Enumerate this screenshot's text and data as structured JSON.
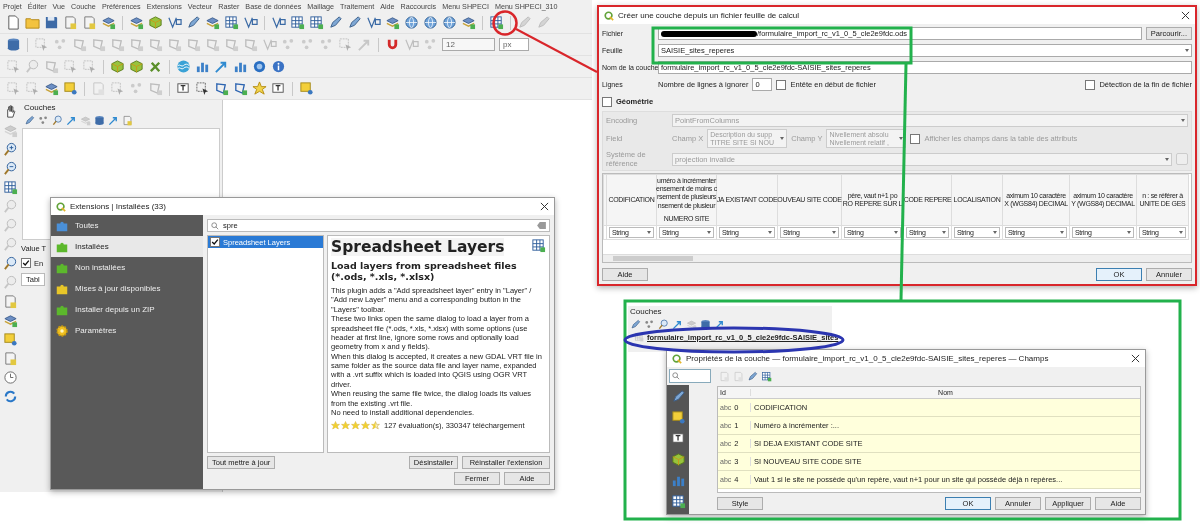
{
  "main_window": {
    "menu": [
      "Projet",
      "Éditer",
      "Vue",
      "Couche",
      "Préférences",
      "Extensions",
      "Vecteur",
      "Raster",
      "Base de données",
      "Maillage",
      "Traitement",
      "Aide",
      "Raccourcis",
      "Menu SHPECI",
      "Menu SHPECI_310"
    ],
    "snapping": {
      "tolerance": "12",
      "unit": "px"
    },
    "layers_panel": {
      "title": "Couches"
    },
    "value_tool": {
      "title": "Value T",
      "checkbox_label": "En",
      "checked": true,
      "tab": "Tabl"
    }
  },
  "extensions_dialog": {
    "title": "Extensions | Installées (33)",
    "sections": [
      {
        "kind": "all",
        "label": "Toutes",
        "selected": false
      },
      {
        "kind": "installed",
        "label": "Installées",
        "selected": true
      },
      {
        "kind": "not_installed",
        "label": "Non installées",
        "selected": false
      },
      {
        "kind": "upgradeable",
        "label": "Mises à jour disponibles",
        "selected": false
      },
      {
        "kind": "zip",
        "label": "Installer depuis un ZIP",
        "selected": false
      },
      {
        "kind": "settings",
        "label": "Paramètres",
        "selected": false
      }
    ],
    "search": {
      "value": "spre"
    },
    "plugins": [
      {
        "name": "Spreadsheet Layers",
        "checked": true,
        "selected": true
      }
    ],
    "details": {
      "title": "Spreadsheet Layers",
      "subtitle": "Load layers from spreadsheet files (*.ods, *.xls, *.xlsx)",
      "paragraphs": [
        "This plugin adds a \"Add spreadsheet layer\" entry in \"Layer\" / \"Add new Layer\" menu and a corresponding button in the \"Layers\" toolbar.",
        "These two links open the same dialog to load a layer from a spreadsheet file (*.ods, *.xls, *.xlsx) with some options (use header at first line, ignore some rows and optionally load geometry from x and y fields).",
        "When this dialog is accepted, it creates a new GDAL VRT file in same folder as the source data file and layer name, expanded with a .vrt suffix which is loaded into QGIS using OGR VRT driver.",
        "When reusing the same file twice, the dialog loads its values from the existing .vrt file.",
        "No need to install additional dependencies."
      ],
      "stars": 4.5,
      "rating": "127 évaluation(s), 330347 téléchargement"
    },
    "buttons": [
      "Tout mettre à jour",
      "Désinstaller",
      "Réinstaller l'extension",
      "Fermer",
      "Aide"
    ]
  },
  "import_dialog": {
    "title": "Créer une couche depuis un fichier feuille de calcul",
    "file": {
      "label": "Fichier",
      "value": "/formulaire_import_rc_v1_0_5_cle2e9fdc.ods",
      "redacted": true,
      "browse": "Parcourir..."
    },
    "sheet": {
      "label": "Feuille",
      "value": "SAISIE_sites_reperes"
    },
    "layer_name": {
      "label": "Nom de la couche",
      "value": "formulaire_import_rc_v1_0_5_cle2e9fdc-SAISIE_sites_reperes"
    },
    "lines": {
      "label": "Lignes",
      "skip_label": "Nombre de lignes à ignorer",
      "skip_value": "0",
      "header_label": "Entête en début de fichier",
      "header_checked": false,
      "eof_label": "Détection de la fin de fichier",
      "eof_checked": false
    },
    "geometry": {
      "label": "Géométrie",
      "checked": false,
      "encoding_label": "Encoding",
      "encoding": "PointFromColumns",
      "field_label": "Field",
      "x_label": "Champ X",
      "x_lines": [
        "Description du supp",
        "TITRE SITE SI NOU"
      ],
      "y_label": "Champ Y",
      "y_lines": [
        "Nivellement absolu",
        "Nivellement relatif ,"
      ],
      "show_label": "Afficher les champs dans la table des attributs",
      "show_checked": false,
      "crs_label": "Système de référence",
      "crs": "projection invalide"
    },
    "columns": [
      {
        "lines": [
          "CODIFICATION"
        ],
        "type": "String"
      },
      {
        "lines": [
          "uméro à incrémenter",
          "ensement de moins c",
          "rsement de plusieurs",
          "nsement de plusieur"
        ],
        "footer": "NUMERO SITE",
        "type": "String"
      },
      {
        "lines": [
          "JA EXISTANT CODE"
        ],
        "type": "String"
      },
      {
        "lines": [
          "OUVEAU SITE CODE"
        ],
        "type": "String"
      },
      {
        "lines": [
          "père, vaut n+1 po",
          "RO REPERE SUR L"
        ],
        "type": "String"
      },
      {
        "lines": [
          "CODE REPERE"
        ],
        "type": "String"
      },
      {
        "lines": [
          "LOCALISATION"
        ],
        "type": "String"
      },
      {
        "lines": [
          "aximum 10 caractère",
          "X (WGS84) DECIMAL"
        ],
        "type": "String"
      },
      {
        "lines": [
          "aximum 10 caractère",
          "Y (WGS84) DECIMAL"
        ],
        "type": "String"
      },
      {
        "lines": [
          "n : se référer à",
          "UNITE DE GES"
        ],
        "type": "String"
      }
    ],
    "buttons": [
      "Aide",
      "OK",
      "Annuler"
    ]
  },
  "result": {
    "layers_panel": {
      "title": "Couches",
      "layer": "formulaire_import_rc_v1_0_5_cle2e9fdc-SAISIE_sites"
    },
    "properties_dialog": {
      "title": "Propriétés de la couche — formulaire_import_rc_v1_0_5_cle2e9fdc-SAISIE_sites_reperes — Champs",
      "columns": [
        "Id",
        "Nom"
      ],
      "fields": [
        {
          "type": "abc",
          "id": "0",
          "name": "CODIFICATION"
        },
        {
          "type": "abc",
          "id": "1",
          "name": "Numéro à incrémenter :..."
        },
        {
          "type": "abc",
          "id": "2",
          "name": "SI DEJA EXISTANT CODE SITE"
        },
        {
          "type": "abc",
          "id": "3",
          "name": "SI NOUVEAU SITE CODE SITE"
        },
        {
          "type": "abc",
          "id": "4",
          "name": "Vaut 1 si le site ne possède qu'un repère, vaut n+1 pour un site qui possède déjà n repères..."
        }
      ],
      "buttons": [
        "Style",
        "OK",
        "Annuler",
        "Appliquer",
        "Aide"
      ]
    }
  }
}
